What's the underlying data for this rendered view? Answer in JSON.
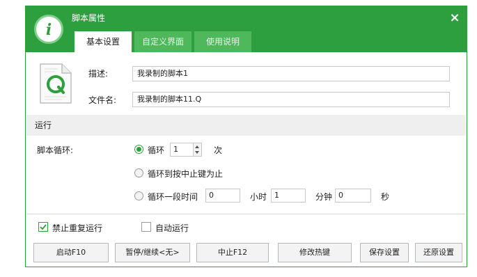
{
  "window": {
    "title": "脚本属性",
    "close_glyph": "×",
    "accent_color": "#2e9f3e"
  },
  "tabs": [
    {
      "label": "基本设置",
      "active": true
    },
    {
      "label": "自定义界面",
      "active": false
    },
    {
      "label": "使用说明",
      "active": false
    }
  ],
  "file_info": {
    "description_label": "描述:",
    "description_value": "我录制的脚本1",
    "filename_label": "文件名:",
    "filename_value": "我录制的脚本11.Q",
    "icon": "q-script-file-icon"
  },
  "run_section": {
    "header": "运行",
    "loop_label": "脚本循环:",
    "options": {
      "loop": {
        "label": "循环",
        "value": "1",
        "unit": "次",
        "selected": true
      },
      "until_stop": {
        "label": "循环到按中止键为止",
        "selected": false
      },
      "duration": {
        "label": "循环一段时间",
        "hours": "0",
        "hours_unit": "小时",
        "minutes": "1",
        "minutes_unit": "分钟",
        "seconds": "0",
        "seconds_unit": "秒",
        "selected": false
      }
    }
  },
  "checkboxes": {
    "no_repeat": {
      "label": "禁止重复运行",
      "checked": true
    },
    "auto_run": {
      "label": "自动运行",
      "checked": false
    }
  },
  "buttons": {
    "start": "启动F10",
    "pause": "暂停/继续<无>",
    "stop": "中止F12",
    "hotkey": "修改热键",
    "save": "保存设置",
    "restore": "还原设置"
  }
}
